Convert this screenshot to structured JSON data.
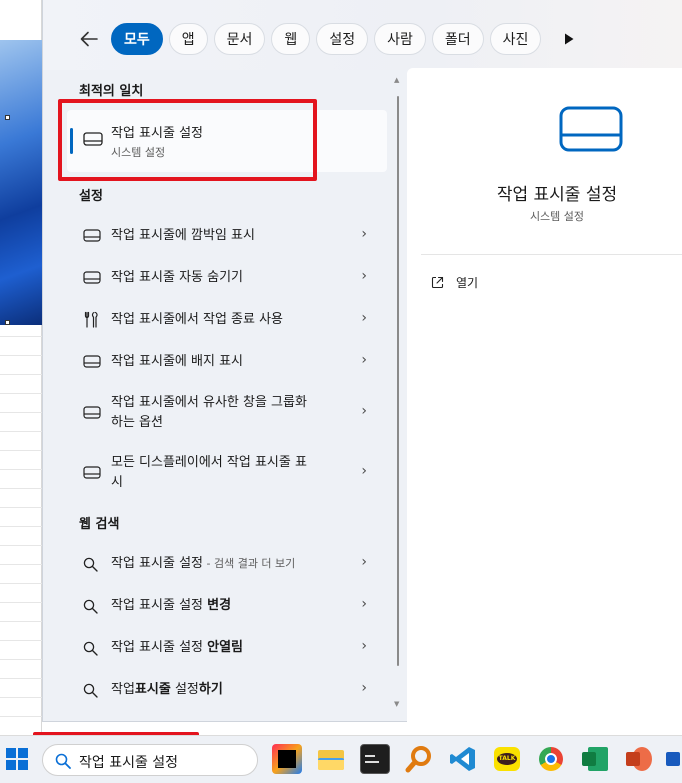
{
  "filters": {
    "tabs": [
      "모두",
      "앱",
      "문서",
      "웹",
      "설정",
      "사람",
      "폴더",
      "사진"
    ],
    "active": "모두"
  },
  "best_match": {
    "section": "최적의 일치",
    "title": "작업 표시줄 설정",
    "subtitle": "시스템 설정"
  },
  "settings": {
    "section": "설정",
    "items": [
      {
        "icon": "taskbar-icon",
        "label": "작업 표시줄에 깜박임 표시"
      },
      {
        "icon": "taskbar-icon",
        "label": "작업 표시줄 자동 숨기기"
      },
      {
        "icon": "tools-icon",
        "label": "작업 표시줄에서 작업 종료 사용"
      },
      {
        "icon": "taskbar-icon",
        "label": "작업 표시줄에 배지 표시"
      },
      {
        "icon": "taskbar-icon",
        "label": "작업 표시줄에서 유사한 창을 그룹화",
        "label2": "하는 옵션"
      },
      {
        "icon": "taskbar-icon",
        "label": "모든 디스플레이에서 작업 표시줄 표",
        "label2": "시"
      }
    ]
  },
  "web": {
    "section": "웹 검색",
    "items": [
      {
        "query": "작업 표시줄 설정",
        "hint": " - 검색 결과 더 보기"
      },
      {
        "prefix": "작업 표시줄 설정 ",
        "bold": "변경"
      },
      {
        "prefix": "작업 표시줄 설정 ",
        "bold": "안열림"
      },
      {
        "p1": "작업",
        "b1": "표시줄",
        "p2": " 설정",
        "b2": "하기"
      }
    ]
  },
  "preview": {
    "title": "작업 표시줄 설정",
    "subtitle": "시스템 설정",
    "open_label": "열기"
  },
  "taskbar": {
    "search_query": "작업 표시줄 설정",
    "apps": [
      "intellij-icon",
      "file-explorer-icon",
      "terminal-icon",
      "search-tool-icon",
      "vscode-icon",
      "kakaotalk-icon",
      "chrome-icon",
      "excel-icon",
      "powerpoint-icon",
      "word-icon"
    ],
    "kakao_label": "TALK"
  },
  "colors": {
    "accent": "#0067c0",
    "highlight": "#e3141e"
  }
}
